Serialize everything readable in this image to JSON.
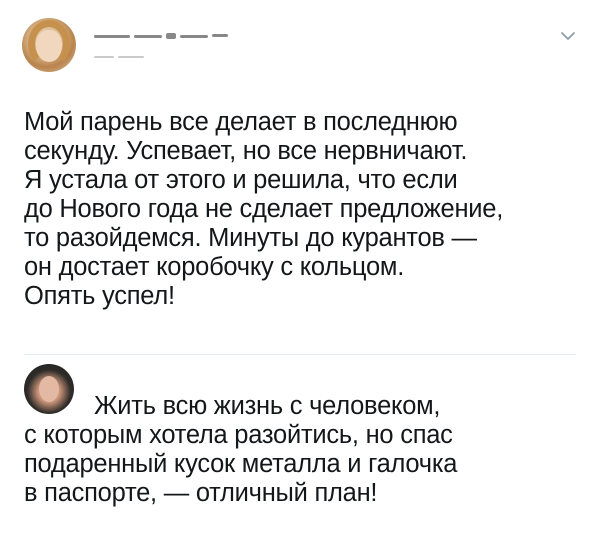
{
  "post": {
    "author_avatar": "profile-photo",
    "more_icon": "chevron-down-icon",
    "text_lines": [
      "Мой парень все делает в последнюю",
      "секунду. Успевает, но все нервничают.",
      "Я устала от этого и решила, что если",
      "до Нового года не сделает предложение,",
      "то разойдемся. Минуты до курантов —",
      "он достает коробочку с кольцом.",
      "Опять успел!"
    ]
  },
  "reply": {
    "author_avatar": "profile-photo",
    "text_lines": [
      "Жить всю жизнь с человеком,",
      "с которым хотела разойтись, но спас",
      "подаренный кусок металла и галочка",
      "в паспорте, — отличный план!"
    ]
  },
  "colors": {
    "text": "#14171a",
    "divider": "#e6ecf0",
    "chevron": "#8899a6"
  }
}
